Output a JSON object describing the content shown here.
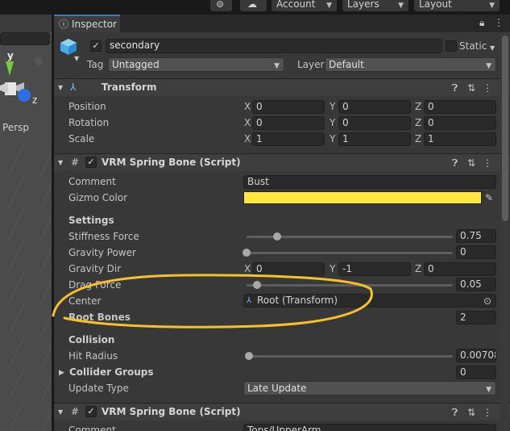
{
  "toolbar": {
    "account_label": "Account",
    "layers_label": "Layers",
    "layout_label": "Layout"
  },
  "scene": {
    "persp_label": "Persp",
    "axis_y": "y",
    "axis_z": "z"
  },
  "inspector": {
    "tab_label": "Inspector",
    "object_name": "secondary",
    "static_label": "Static",
    "tag_label": "Tag",
    "tag_value": "Untagged",
    "layer_label": "Layer",
    "layer_value": "Default"
  },
  "transform": {
    "title": "Transform",
    "position_label": "Position",
    "rotation_label": "Rotation",
    "scale_label": "Scale",
    "axis_x": "X",
    "axis_y": "Y",
    "axis_z": "Z",
    "position": [
      "0",
      "0",
      "0"
    ],
    "rotation": [
      "0",
      "0",
      "0"
    ],
    "scale": [
      "1",
      "1",
      "1"
    ]
  },
  "spring_bone_1": {
    "title": "VRM Spring Bone (Script)",
    "comment_label": "Comment",
    "comment_value": "Bust",
    "gizmo_color_label": "Gizmo Color",
    "gizmo_color": "#fde740",
    "settings_label": "Settings",
    "stiffness_label": "Stiffness Force",
    "stiffness_value": "0.75",
    "stiffness_level": 0.15,
    "gravity_power_label": "Gravity Power",
    "gravity_power_value": "0",
    "gravity_power_level": 0.0,
    "gravity_dir_label": "Gravity Dir",
    "gravity_dir": [
      "0",
      "-1",
      "0"
    ],
    "drag_force_label": "Drag Force",
    "drag_force_value": "0.05",
    "drag_force_level": 0.05,
    "center_label": "Center",
    "center_value": "Root (Transform)",
    "root_bones_label": "Root Bones",
    "root_bones_value": "2",
    "collision_label": "Collision",
    "hit_radius_label": "Hit Radius",
    "hit_radius_value": "0.00708",
    "hit_radius_level": 0.01,
    "collider_groups_label": "Collider Groups",
    "collider_groups_value": "0",
    "update_type_label": "Update Type",
    "update_type_value": "Late Update"
  },
  "spring_bone_2": {
    "title": "VRM Spring Bone (Script)",
    "comment_label": "Comment",
    "comment_value": "Tops/UpperArm"
  },
  "colors": {
    "highlight_stroke": "#f7c12e",
    "accent_blue": "#3a79bb"
  }
}
